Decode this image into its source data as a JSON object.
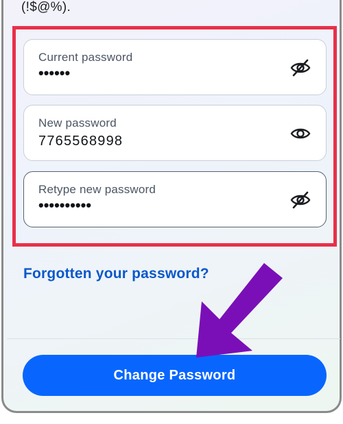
{
  "page": {
    "hint_text": "(!$@%)."
  },
  "form": {
    "fields": [
      {
        "label": "Current password",
        "value": "••••••",
        "masked": true,
        "toggle_icon": "eye-slash-icon"
      },
      {
        "label": "New password",
        "value": "7765568998",
        "masked": false,
        "toggle_icon": "eye-icon"
      },
      {
        "label": "Retype new password",
        "value": "••••••••••",
        "masked": true,
        "toggle_icon": "eye-slash-icon"
      }
    ],
    "forgot_link": "Forgotten your password?",
    "submit_label": "Change Password"
  },
  "colors": {
    "highlight_border": "#e8304a",
    "annotation_arrow": "#7a0fb8",
    "primary_button": "#0866ff",
    "link": "#0a58ca"
  }
}
